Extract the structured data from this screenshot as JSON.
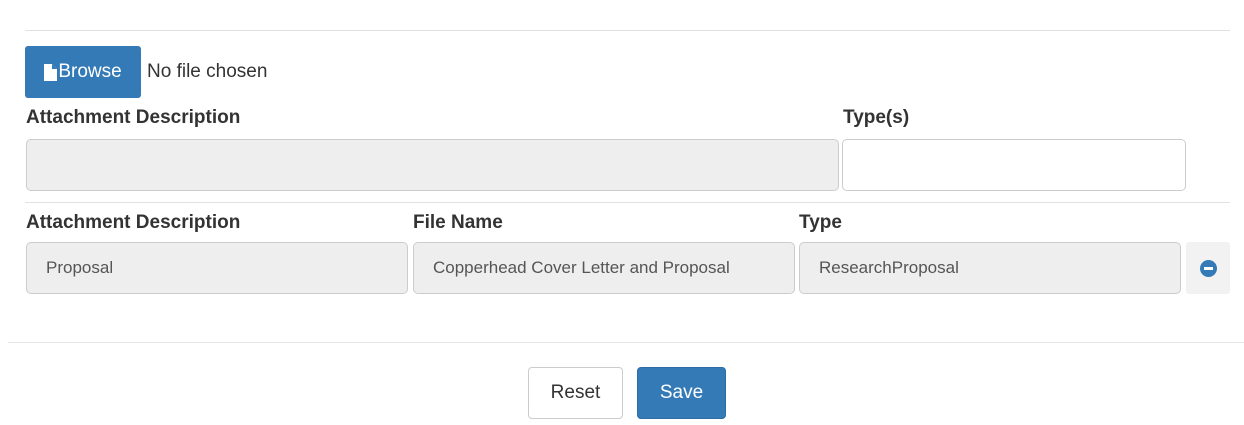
{
  "upload": {
    "browse_label": "Browse",
    "file_status": "No file chosen",
    "description_label": "Attachment Description",
    "description_value": "",
    "types_label": "Type(s)",
    "types_value": ""
  },
  "attachments": {
    "headers": {
      "description": "Attachment Description",
      "file_name": "File Name",
      "type": "Type"
    },
    "rows": [
      {
        "description": "Proposal",
        "file_name": "Copperhead Cover Letter and Proposal",
        "type": "ResearchProposal"
      }
    ]
  },
  "actions": {
    "reset_label": "Reset",
    "save_label": "Save"
  },
  "colors": {
    "primary": "#337ab7"
  },
  "icons": {
    "browse": "file-icon",
    "remove": "minus-circle-icon"
  }
}
